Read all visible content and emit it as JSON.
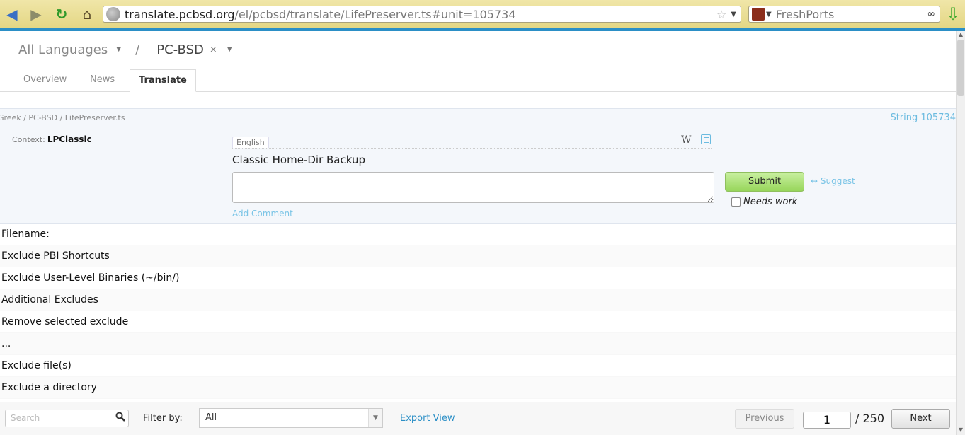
{
  "browser": {
    "url_host": "translate.pcbsd.org",
    "url_path": "/el/pcbsd/translate/LifePreserver.ts#unit=105734",
    "search_engine": "FreshPorts",
    "icons": [
      "back-icon",
      "forward-icon",
      "reload-icon",
      "home-icon",
      "globe-icon",
      "star-icon",
      "binoculars-icon",
      "download-icon"
    ]
  },
  "breadcrumb": {
    "languages": "All Languages",
    "separator": "/",
    "project": "PC-BSD",
    "remove": "×"
  },
  "tabs": [
    {
      "label": "Overview"
    },
    {
      "label": "News"
    },
    {
      "label": "Translate"
    }
  ],
  "unit": {
    "path": "Greek / PC-BSD / LifePreserver.ts",
    "string_number": "String 105734",
    "context_label": "Context:",
    "context_value": "LPClassic",
    "source_language": "English",
    "wiki_label": "W",
    "source_text": "Classic Home-Dir Backup",
    "target_value": "",
    "add_comment": "Add Comment",
    "submit": "Submit",
    "suggest": "↔ Suggest",
    "needs_work": "Needs work"
  },
  "rows": [
    "Filename:",
    "Exclude PBI Shortcuts",
    "Exclude User-Level Binaries (~/bin/)",
    "Additional Excludes",
    "Remove selected exclude",
    "...",
    "Exclude file(s)",
    "Exclude a directory"
  ],
  "footer": {
    "search_placeholder": "Search",
    "filter_label": "Filter by:",
    "filter_value": "All",
    "export": "Export View",
    "previous": "Previous",
    "page": "1",
    "total": "/ 250",
    "next": "Next"
  },
  "colors": {
    "accent": "#2b8fc6",
    "link": "#7ac4e6",
    "submit": "#97d65b",
    "toolbar": "#e4d785"
  }
}
